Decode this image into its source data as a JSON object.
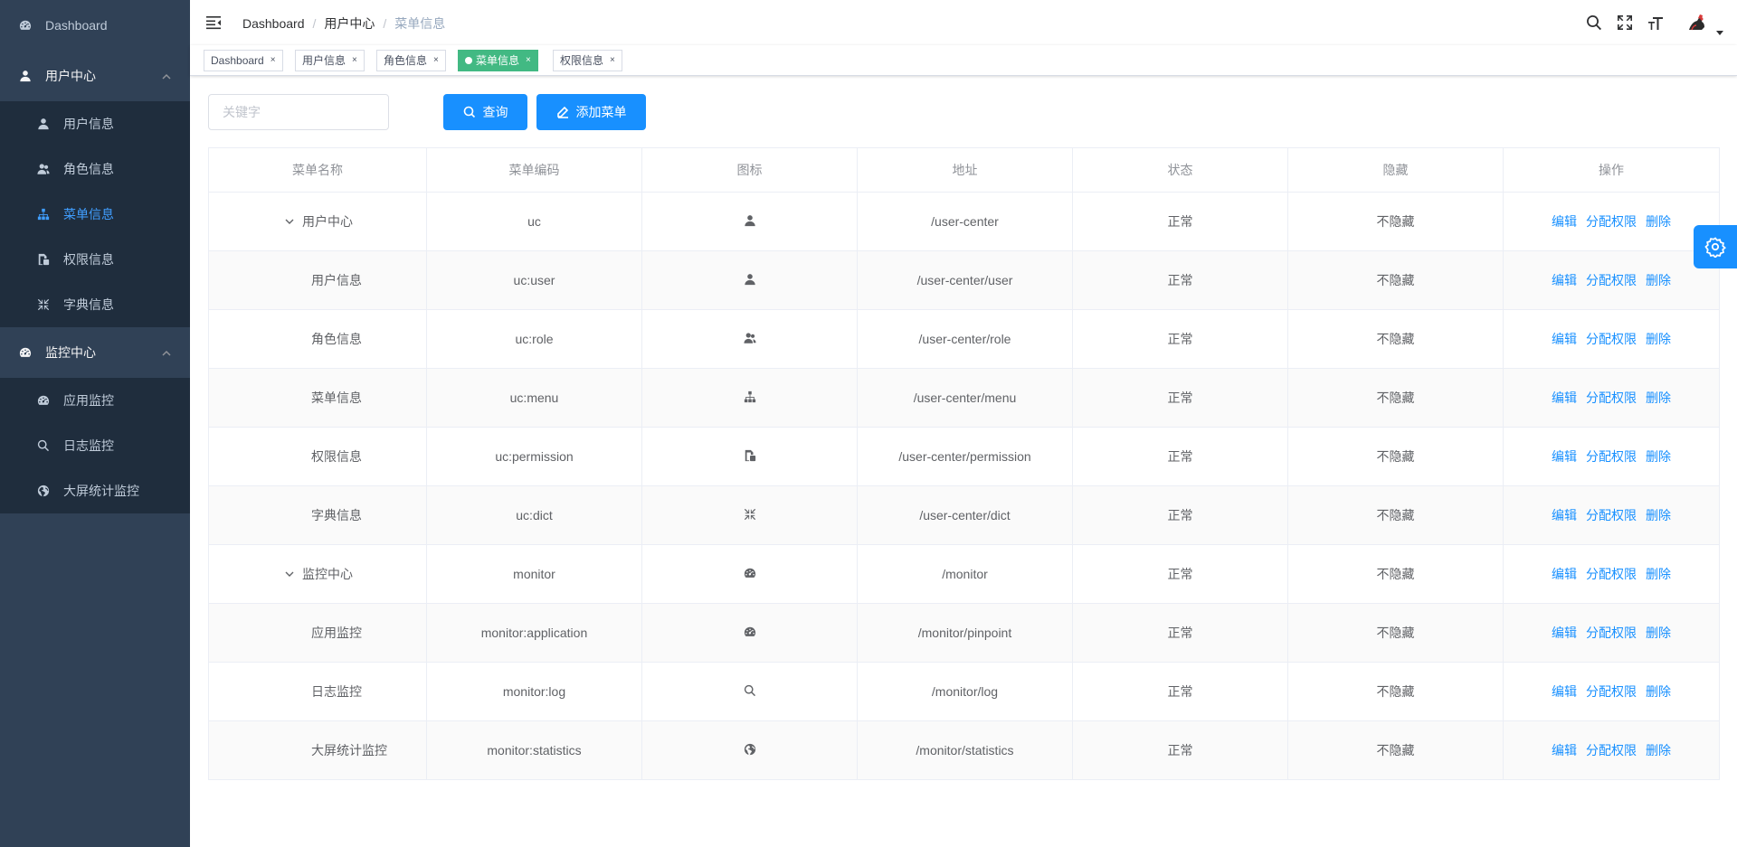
{
  "sidebar": {
    "dashboard": {
      "label": "Dashboard",
      "icon": "dashboard-icon"
    },
    "groups": [
      {
        "label": "用户中心",
        "icon": "user-icon",
        "items": [
          {
            "label": "用户信息",
            "icon": "user-icon"
          },
          {
            "label": "角色信息",
            "icon": "peoples-icon"
          },
          {
            "label": "菜单信息",
            "icon": "tree-icon",
            "active": true
          },
          {
            "label": "权限信息",
            "icon": "permission-icon"
          },
          {
            "label": "字典信息",
            "icon": "compress-icon"
          }
        ]
      },
      {
        "label": "监控中心",
        "icon": "dashboard-icon",
        "items": [
          {
            "label": "应用监控",
            "icon": "dashboard-icon"
          },
          {
            "label": "日志监控",
            "icon": "search-icon"
          },
          {
            "label": "大屏统计监控",
            "icon": "globe-icon"
          }
        ]
      }
    ],
    "active_color": "#409eff"
  },
  "breadcrumb": [
    "Dashboard",
    "用户中心",
    "菜单信息"
  ],
  "tags": [
    {
      "label": "Dashboard",
      "active": false
    },
    {
      "label": "用户信息",
      "active": false
    },
    {
      "label": "角色信息",
      "active": false
    },
    {
      "label": "菜单信息",
      "active": true
    },
    {
      "label": "权限信息",
      "active": false
    }
  ],
  "tag_close": "×",
  "search": {
    "placeholder": "关键字",
    "value": ""
  },
  "buttons": {
    "query": "查询",
    "add_menu": "添加菜单"
  },
  "table": {
    "headers": [
      "菜单名称",
      "菜单编码",
      "图标",
      "地址",
      "状态",
      "隐藏",
      "操作"
    ],
    "rows": [
      {
        "name": "用户中心",
        "code": "uc",
        "icon": "user-icon",
        "path": "/user-center",
        "status": "正常",
        "hidden": "不隐藏",
        "expandable": true,
        "level": 0
      },
      {
        "name": "用户信息",
        "code": "uc:user",
        "icon": "user-icon",
        "path": "/user-center/user",
        "status": "正常",
        "hidden": "不隐藏",
        "expandable": false,
        "level": 1
      },
      {
        "name": "角色信息",
        "code": "uc:role",
        "icon": "peoples-icon",
        "path": "/user-center/role",
        "status": "正常",
        "hidden": "不隐藏",
        "expandable": false,
        "level": 1
      },
      {
        "name": "菜单信息",
        "code": "uc:menu",
        "icon": "tree-icon",
        "path": "/user-center/menu",
        "status": "正常",
        "hidden": "不隐藏",
        "expandable": false,
        "level": 1
      },
      {
        "name": "权限信息",
        "code": "uc:permission",
        "icon": "permission-icon",
        "path": "/user-center/permission",
        "status": "正常",
        "hidden": "不隐藏",
        "expandable": false,
        "level": 1
      },
      {
        "name": "字典信息",
        "code": "uc:dict",
        "icon": "compress-icon",
        "path": "/user-center/dict",
        "status": "正常",
        "hidden": "不隐藏",
        "expandable": false,
        "level": 1
      },
      {
        "name": "监控中心",
        "code": "monitor",
        "icon": "dashboard-icon",
        "path": "/monitor",
        "status": "正常",
        "hidden": "不隐藏",
        "expandable": true,
        "level": 0
      },
      {
        "name": "应用监控",
        "code": "monitor:application",
        "icon": "dashboard-icon",
        "path": "/monitor/pinpoint",
        "status": "正常",
        "hidden": "不隐藏",
        "expandable": false,
        "level": 1
      },
      {
        "name": "日志监控",
        "code": "monitor:log",
        "icon": "search-icon",
        "path": "/monitor/log",
        "status": "正常",
        "hidden": "不隐藏",
        "expandable": false,
        "level": 1
      },
      {
        "name": "大屏统计监控",
        "code": "monitor:statistics",
        "icon": "globe-icon",
        "path": "/monitor/statistics",
        "status": "正常",
        "hidden": "不隐藏",
        "expandable": false,
        "level": 1
      }
    ],
    "actions": [
      "编辑",
      "分配权限",
      "删除"
    ]
  },
  "navbar_icons": [
    "search-icon",
    "fullscreen-icon",
    "font-size-icon"
  ],
  "colors": {
    "sidebar_bg": "#304156",
    "submenu_bg": "#1f2d3d",
    "primary": "#1890ff",
    "tag_active": "#42b983"
  }
}
